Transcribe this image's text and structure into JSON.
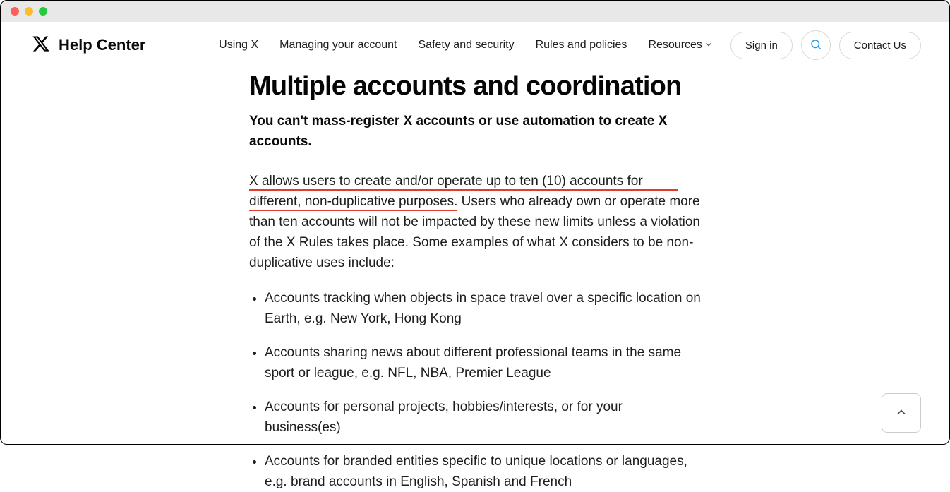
{
  "brand": {
    "title": "Help Center"
  },
  "nav": {
    "items": [
      "Using X",
      "Managing your account",
      "Safety and security",
      "Rules and policies"
    ],
    "resources": "Resources"
  },
  "actions": {
    "sign_in": "Sign in",
    "contact": "Contact Us"
  },
  "article": {
    "heading": "Multiple accounts and coordination",
    "subtitle": "You can't mass-register X accounts or use automation to create X accounts.",
    "para_underlined_1": "X allows users to create and/or operate up to ten (10) accounts for",
    "para_underlined_2": "different, non-duplicative purposes.",
    "para_rest": " Users who already own or operate more than ten accounts will not be impacted by these new limits unless a violation of the X Rules takes place. Some examples of what X considers to be non-duplicative uses include:",
    "bullets": [
      "Accounts tracking when objects in space travel over a specific location on Earth, e.g. New York, Hong Kong",
      "Accounts sharing news about different professional teams in the same sport or league, e.g. NFL, NBA, Premier League",
      "Accounts for personal projects, hobbies/interests, or for your business(es)",
      "Accounts for branded entities specific to unique locations or languages, e.g. brand accounts in English, Spanish and French"
    ]
  }
}
